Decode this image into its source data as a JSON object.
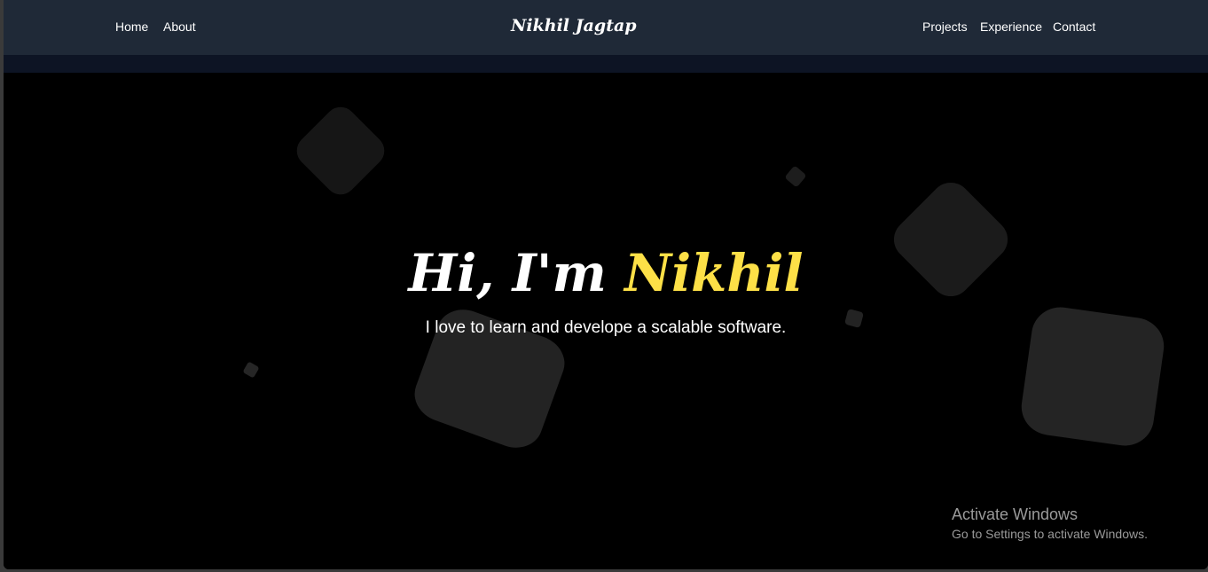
{
  "navbar": {
    "left_links": [
      "Home",
      "About"
    ],
    "brand": "Nikhil Jagtap",
    "right_links": [
      "Projects",
      "Experience",
      "Contact"
    ]
  },
  "hero": {
    "greeting": "Hi, I'm",
    "name": "Nikhil",
    "subtitle": "I love to learn and develope a scalable software."
  },
  "windows_activation": {
    "title": "Activate Windows",
    "message": "Go to Settings to activate Windows."
  },
  "colors": {
    "navbar_bg": "#1f2937",
    "hero_bg": "#000000",
    "accent_name": "#fde047",
    "text": "#ffffff"
  }
}
